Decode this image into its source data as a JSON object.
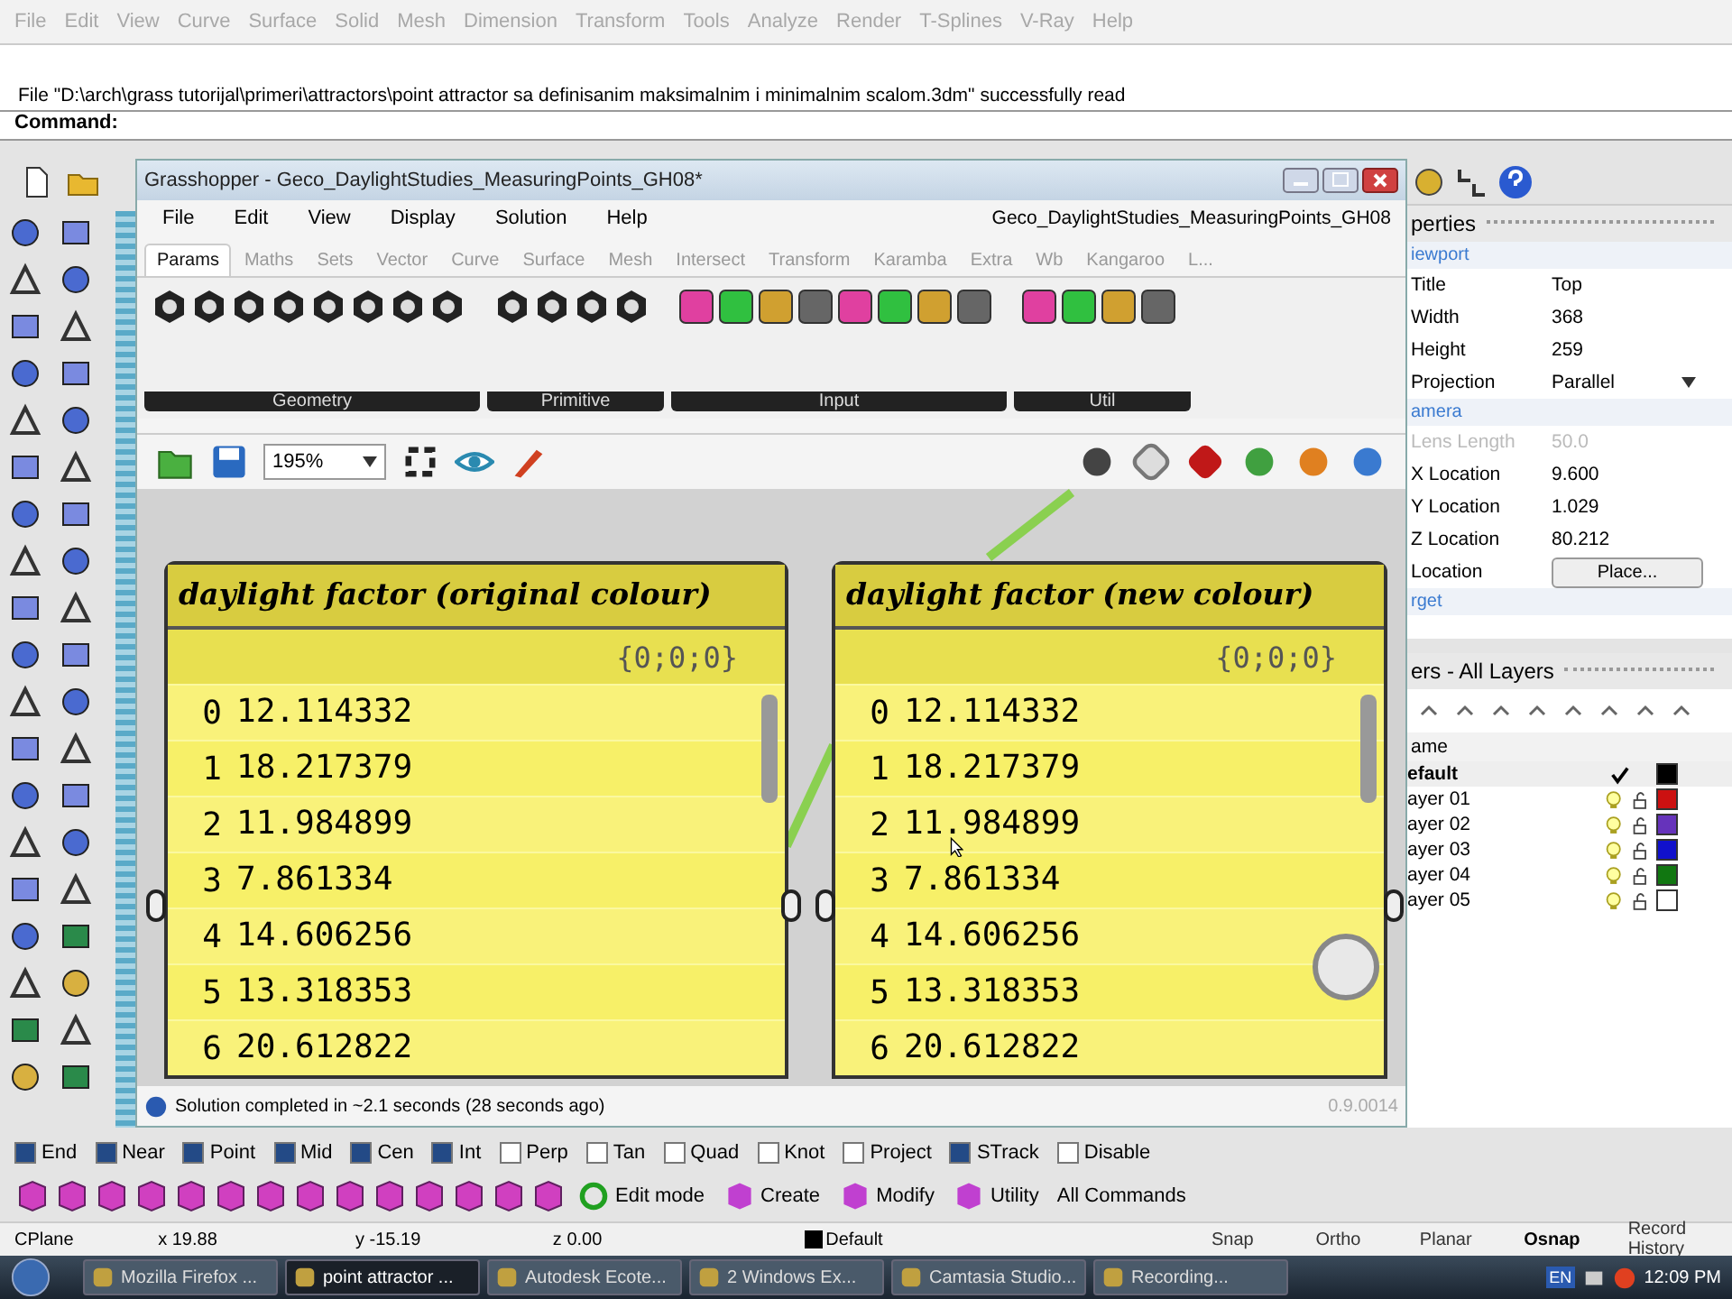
{
  "rhino_menu": [
    "File",
    "Edit",
    "View",
    "Curve",
    "Surface",
    "Solid",
    "Mesh",
    "Dimension",
    "Transform",
    "Tools",
    "Analyze",
    "Render",
    "T-Splines",
    "V-Ray",
    "Help"
  ],
  "command_history": "File \"D:\\arch\\grass tutorijal\\primeri\\attractors\\point attractor sa definisanim maksimalnim i minimalnim scalom.3dm\" successfully read",
  "command_prompt": "Command:",
  "grasshopper": {
    "title": "Grasshopper - Geco_DaylightStudies_MeasuringPoints_GH08*",
    "menu": [
      "File",
      "Edit",
      "View",
      "Display",
      "Solution",
      "Help"
    ],
    "document": "Geco_DaylightStudies_MeasuringPoints_GH08",
    "tabs": [
      {
        "label": "Params",
        "selected": true
      },
      {
        "label": "Maths",
        "selected": false
      },
      {
        "label": "Sets",
        "selected": false
      },
      {
        "label": "Vector",
        "selected": false
      },
      {
        "label": "Curve",
        "selected": false
      },
      {
        "label": "Surface",
        "selected": false
      },
      {
        "label": "Mesh",
        "selected": false
      },
      {
        "label": "Intersect",
        "selected": false
      },
      {
        "label": "Transform",
        "selected": false
      },
      {
        "label": "Karamba",
        "selected": false
      },
      {
        "label": "Extra",
        "selected": false
      },
      {
        "label": "Wb",
        "selected": false
      },
      {
        "label": "Kangaroo",
        "selected": false
      },
      {
        "label": "L...",
        "selected": false
      }
    ],
    "palette_groups": [
      "Geometry",
      "Primitive",
      "Input",
      "Util"
    ],
    "zoom": "195%",
    "panels": [
      {
        "title": "daylight factor (original colour)",
        "path": "{0;0;0}",
        "rows": [
          {
            "index": "0",
            "value": "12.114332"
          },
          {
            "index": "1",
            "value": "18.217379"
          },
          {
            "index": "2",
            "value": "11.984899"
          },
          {
            "index": "3",
            "value": "7.861334"
          },
          {
            "index": "4",
            "value": "14.606256"
          },
          {
            "index": "5",
            "value": "13.318353"
          },
          {
            "index": "6",
            "value": "20.612822"
          }
        ]
      },
      {
        "title": "daylight factor (new colour)",
        "path": "{0;0;0}",
        "rows": [
          {
            "index": "0",
            "value": "12.114332"
          },
          {
            "index": "1",
            "value": "18.217379"
          },
          {
            "index": "2",
            "value": "11.984899"
          },
          {
            "index": "3",
            "value": "7.861334"
          },
          {
            "index": "4",
            "value": "14.606256"
          },
          {
            "index": "5",
            "value": "13.318353"
          },
          {
            "index": "6",
            "value": "20.612822"
          }
        ]
      }
    ],
    "status": "Solution completed in ~2.1 seconds (28 seconds ago)",
    "version": "0.9.0014"
  },
  "properties": {
    "title": "perties",
    "sections": [
      {
        "label": "iewport",
        "rows": [
          {
            "name": "Title",
            "value": "Top",
            "disabled": false
          },
          {
            "name": "Width",
            "value": "368",
            "disabled": false
          },
          {
            "name": "Height",
            "value": "259",
            "disabled": false
          },
          {
            "name": "Projection",
            "value": "Parallel",
            "disabled": false,
            "kind": "dropdown"
          }
        ]
      },
      {
        "label": "amera",
        "rows": [
          {
            "name": "Lens Length",
            "value": "50.0",
            "disabled": true
          },
          {
            "name": "X Location",
            "value": "9.600",
            "disabled": false
          },
          {
            "name": "Y Location",
            "value": "1.029",
            "disabled": false
          },
          {
            "name": "Z Location",
            "value": "80.212",
            "disabled": false
          },
          {
            "name": "Location",
            "value": "Place...",
            "disabled": false,
            "kind": "button"
          }
        ]
      },
      {
        "label": "rget"
      }
    ]
  },
  "layers": {
    "title": "ers - All Layers",
    "column": "ame",
    "rows": [
      {
        "name": "efault",
        "current": true,
        "color": "#000000"
      },
      {
        "name": "ayer 01",
        "current": false,
        "color": "#cc1111"
      },
      {
        "name": "ayer 02",
        "current": false,
        "color": "#6633bb"
      },
      {
        "name": "ayer 03",
        "current": false,
        "color": "#1111cc"
      },
      {
        "name": "ayer 04",
        "current": false,
        "color": "#117711"
      },
      {
        "name": "ayer 05",
        "current": false,
        "color": "#ffffff"
      }
    ]
  },
  "osnaps": [
    {
      "label": "End",
      "checked": true
    },
    {
      "label": "Near",
      "checked": true
    },
    {
      "label": "Point",
      "checked": true
    },
    {
      "label": "Mid",
      "checked": true
    },
    {
      "label": "Cen",
      "checked": true
    },
    {
      "label": "Int",
      "checked": true
    },
    {
      "label": "Perp",
      "checked": false
    },
    {
      "label": "Tan",
      "checked": false
    },
    {
      "label": "Quad",
      "checked": false
    },
    {
      "label": "Knot",
      "checked": false
    },
    {
      "label": "Project",
      "checked": false
    },
    {
      "label": "STrack",
      "checked": true
    },
    {
      "label": "Disable",
      "checked": false
    }
  ],
  "command_buttons": [
    "Edit mode",
    "Create",
    "Modify",
    "Utility",
    "All Commands"
  ],
  "status_bar": {
    "cplane": "CPlane",
    "x": "x 19.88",
    "y": "y -15.19",
    "z": "z 0.00",
    "layer": "Default",
    "toggles": [
      {
        "label": "Snap",
        "on": false
      },
      {
        "label": "Ortho",
        "on": false
      },
      {
        "label": "Planar",
        "on": false
      },
      {
        "label": "Osnap",
        "on": true
      },
      {
        "label": "Record History",
        "on": false
      }
    ]
  },
  "taskbar": {
    "tasks": [
      {
        "label": "Mozilla Firefox ...",
        "selected": false
      },
      {
        "label": "point attractor ...",
        "selected": true
      },
      {
        "label": "Autodesk Ecote...",
        "selected": false
      },
      {
        "label": "2 Windows Ex...",
        "selected": false
      },
      {
        "label": "Camtasia Studio...",
        "selected": false
      },
      {
        "label": "Recording...",
        "selected": false
      }
    ],
    "language": "EN",
    "clock": "12:09 PM"
  }
}
